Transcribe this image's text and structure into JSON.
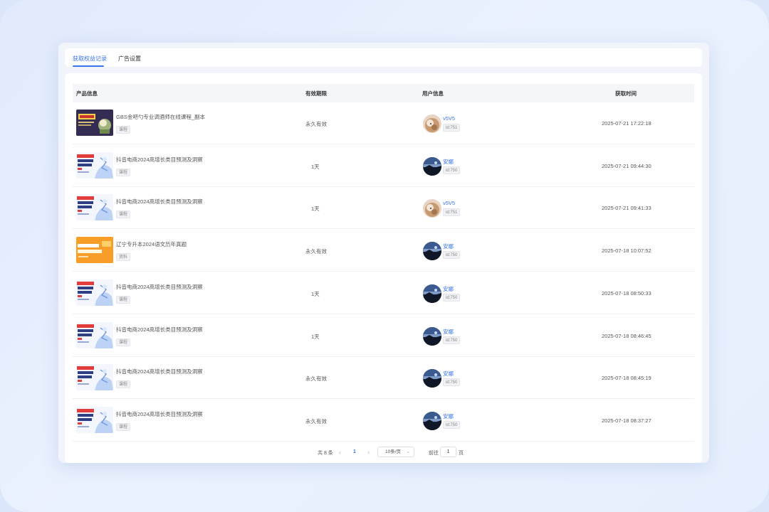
{
  "tabs": [
    {
      "label": "获取权益记录",
      "active": true
    },
    {
      "label": "广告设置",
      "active": false
    }
  ],
  "table": {
    "headers": {
      "product": "产品信息",
      "validity": "有效期限",
      "user": "用户信息",
      "time": "获取时间"
    },
    "rows": [
      {
        "thumb": "bar-course",
        "title": "GBS金吧勺专业调酒师在线课程_副本",
        "tag": "课程",
        "validity": "永久有效",
        "avatar": "cat",
        "user": "v5V5",
        "uid": "id:751",
        "time": "2025-07-21 17:22:18"
      },
      {
        "thumb": "douyin",
        "title": "抖音电商2024高增长类目预测及洞察",
        "tag": "课程",
        "validity": "1天",
        "avatar": "dusk",
        "user": "安娜",
        "uid": "id:750",
        "time": "2025-07-21 09:44:30"
      },
      {
        "thumb": "douyin",
        "title": "抖音电商2024高增长类目预测及洞察",
        "tag": "课程",
        "validity": "1天",
        "avatar": "cat",
        "user": "v5V5",
        "uid": "id:751",
        "time": "2025-07-21 09:41:33"
      },
      {
        "thumb": "exam",
        "title": "辽宁专升本2024语文历年真题",
        "tag": "资料",
        "validity": "永久有效",
        "avatar": "dusk",
        "user": "安娜",
        "uid": "id:750",
        "time": "2025-07-18 10:07:52"
      },
      {
        "thumb": "douyin",
        "title": "抖音电商2024高增长类目预测及洞察",
        "tag": "课程",
        "validity": "1天",
        "avatar": "dusk",
        "user": "安娜",
        "uid": "id:750",
        "time": "2025-07-18 08:50:33"
      },
      {
        "thumb": "douyin",
        "title": "抖音电商2024高增长类目预测及洞察",
        "tag": "课程",
        "validity": "1天",
        "avatar": "dusk",
        "user": "安娜",
        "uid": "id:750",
        "time": "2025-07-18 08:46:45"
      },
      {
        "thumb": "douyin",
        "title": "抖音电商2024高增长类目预测及洞察",
        "tag": "课程",
        "validity": "永久有效",
        "avatar": "dusk",
        "user": "安娜",
        "uid": "id:750",
        "time": "2025-07-18 08:45:19"
      },
      {
        "thumb": "douyin",
        "title": "抖音电商2024高增长类目预测及洞察",
        "tag": "课程",
        "validity": "永久有效",
        "avatar": "dusk",
        "user": "安娜",
        "uid": "id:750",
        "time": "2025-07-18 08:37:27"
      }
    ]
  },
  "pagination": {
    "total": "共 8 条",
    "prev_icon": "chevron-left-icon",
    "next_icon": "chevron-right-icon",
    "current": "1",
    "page_size": "10条/页",
    "goto_prefix": "前往",
    "goto_value": "1",
    "goto_suffix": "页"
  },
  "colors": {
    "accent": "#3a74e8",
    "background": "#dbe6fb",
    "header_bg": "#f4f6fa"
  }
}
